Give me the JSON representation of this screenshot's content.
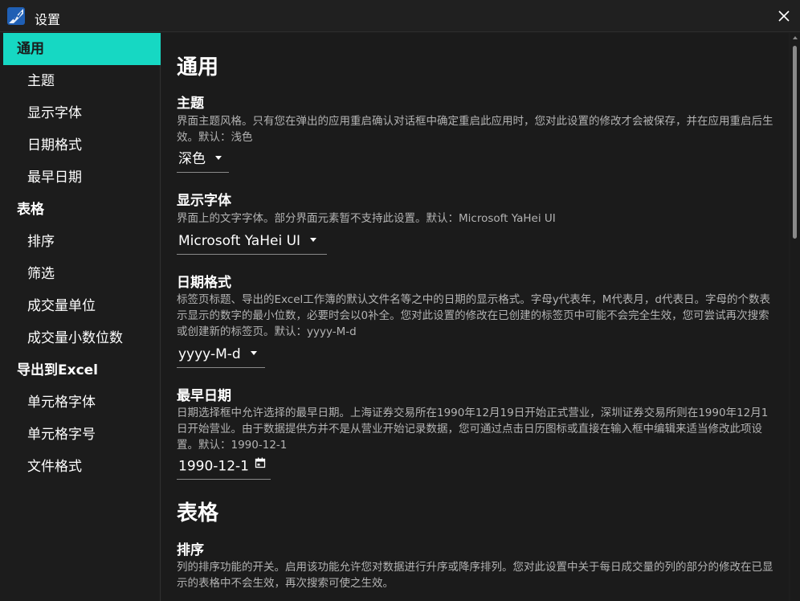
{
  "window": {
    "title": "设置",
    "app_icon": "app-logo-icon",
    "close_icon": "close-icon"
  },
  "sidebar": {
    "items": [
      {
        "label": "通用",
        "type": "group",
        "active": true
      },
      {
        "label": "主题",
        "type": "sub"
      },
      {
        "label": "显示字体",
        "type": "sub"
      },
      {
        "label": "日期格式",
        "type": "sub"
      },
      {
        "label": "最早日期",
        "type": "sub"
      },
      {
        "label": "表格",
        "type": "group"
      },
      {
        "label": "排序",
        "type": "sub"
      },
      {
        "label": "筛选",
        "type": "sub"
      },
      {
        "label": "成交量单位",
        "type": "sub"
      },
      {
        "label": "成交量小数位数",
        "type": "sub"
      },
      {
        "label": "导出到Excel",
        "type": "group"
      },
      {
        "label": "单元格字体",
        "type": "sub"
      },
      {
        "label": "单元格字号",
        "type": "sub"
      },
      {
        "label": "文件格式",
        "type": "sub"
      }
    ]
  },
  "content": {
    "general": {
      "heading": "通用",
      "theme": {
        "title": "主题",
        "description": "界面主题风格。只有您在弹出的应用重启确认对话框中确定重启此应用时，您对此设置的修改才会被保存，并在应用重启后生效。默认：浅色",
        "value": "深色"
      },
      "font": {
        "title": "显示字体",
        "description": "界面上的文字字体。部分界面元素暂不支持此设置。默认：Microsoft YaHei UI",
        "value": "Microsoft YaHei UI"
      },
      "date_format": {
        "title": "日期格式",
        "description": "标签页标题、导出的Excel工作簿的默认文件名等之中的日期的显示格式。字母y代表年，M代表月，d代表日。字母的个数表示显示的数字的最小位数，必要时会以0补全。您对此设置的修改在已创建的标签页中可能不会完全生效，您可尝试再次搜索或创建新的标签页。默认：yyyy-M-d",
        "value": "yyyy-M-d"
      },
      "earliest_date": {
        "title": "最早日期",
        "description": "日期选择框中允许选择的最早日期。上海证券交易所在1990年12月19日开始正式营业，深圳证券交易所则在1990年12月1日开始营业。由于数据提供方并不是从营业开始记录数据，您可通过点击日历图标或直接在输入框中编辑来适当修改此项设置。默认：1990-12-1",
        "value": "1990-12-1"
      }
    },
    "table": {
      "heading": "表格",
      "sort": {
        "title": "排序",
        "description": "列的排序功能的开关。启用该功能允许您对数据进行升序或降序排列。您对此设置中关于每日成交量的列的部分的修改在已显示的表格中不会生效，再次搜索可使之生效。"
      }
    }
  },
  "colors": {
    "accent": "#16d8c3",
    "background": "#1b1b1b",
    "sidebar": "#1c1c1c",
    "text_secondary": "#b3b3b3"
  }
}
